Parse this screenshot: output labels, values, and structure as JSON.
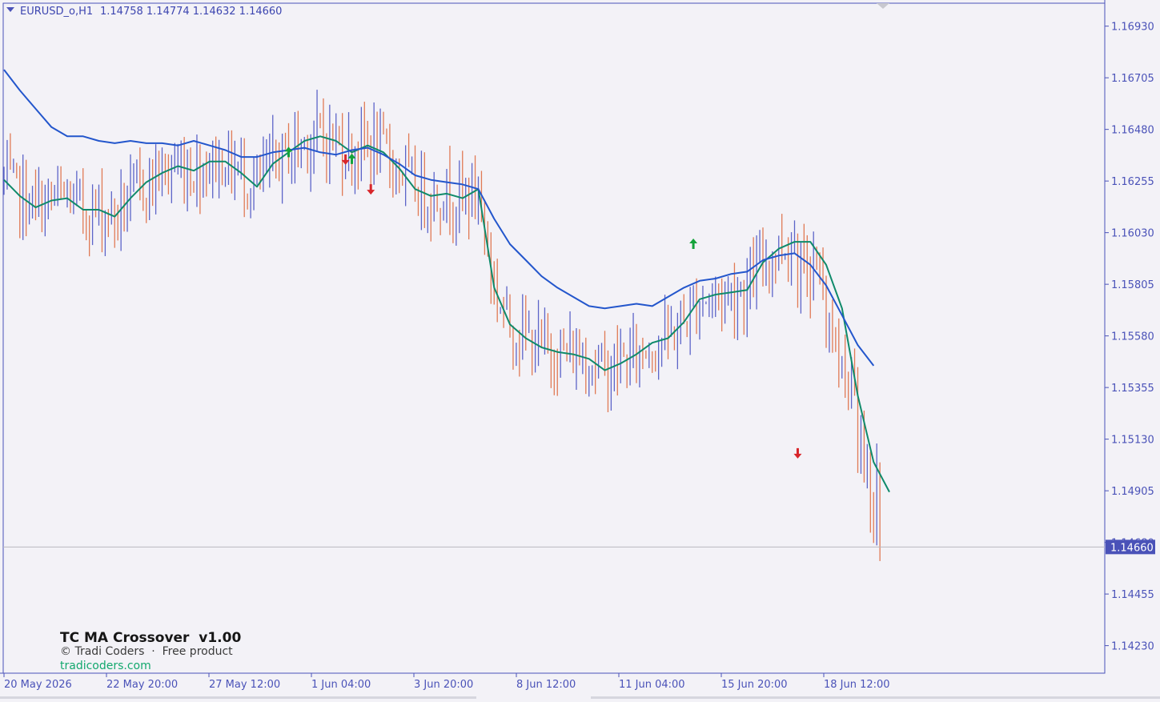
{
  "header": {
    "symbol": "EURUSD_o,H1",
    "ohlc": "1.14758 1.14774 1.14632 1.14660"
  },
  "current_price_label": "1.14660",
  "watermark": {
    "title": "TC MA Crossover  v1.00",
    "line2": "© Tradi Coders  ·  Free product",
    "line3": "tradicoders.com"
  },
  "colors": {
    "background": "#f3f2f7",
    "axis": "#4a52b8",
    "bull_bar": "#5c64c8",
    "bear_bar": "#e07a55",
    "fast_ma": "#0f8a6a",
    "slow_ma": "#2356cc",
    "buy_arrow": "#14a33a",
    "sell_arrow": "#d8252a",
    "price_label_bg": "#4a52b8",
    "watermark_link": "#13a86e"
  },
  "chart_data": {
    "type": "line",
    "title": "",
    "symbol": "EURUSD_o",
    "timeframe": "H1",
    "ylim": [
      1.1411,
      1.1703
    ],
    "y_ticks": [
      1.1693,
      1.16705,
      1.1648,
      1.16255,
      1.1603,
      1.15805,
      1.1558,
      1.15355,
      1.1513,
      1.14905,
      1.1468,
      1.14455,
      1.1423
    ],
    "x_tick_labels": [
      "20 May 2026",
      "22 May 20:00",
      "27 May 12:00",
      "1 Jun 04:00",
      "3 Jun 20:00",
      "8 Jun 12:00",
      "11 Jun 04:00",
      "15 Jun 20:00",
      "18 Jun 12:00"
    ],
    "current_price": 1.1466,
    "series": [
      {
        "kind": "fast_ma",
        "points": [
          [
            0,
            1.1626
          ],
          [
            5,
            1.1619
          ],
          [
            10,
            1.1614
          ],
          [
            15,
            1.1617
          ],
          [
            20,
            1.1618
          ],
          [
            25,
            1.1613
          ],
          [
            30,
            1.1613
          ],
          [
            35,
            1.161
          ],
          [
            40,
            1.1618
          ],
          [
            45,
            1.1625
          ],
          [
            50,
            1.1629
          ],
          [
            55,
            1.1632
          ],
          [
            60,
            1.163
          ],
          [
            65,
            1.1634
          ],
          [
            70,
            1.1634
          ],
          [
            75,
            1.1629
          ],
          [
            80,
            1.1623
          ],
          [
            85,
            1.1633
          ],
          [
            90,
            1.1638
          ],
          [
            95,
            1.1643
          ],
          [
            100,
            1.1645
          ],
          [
            105,
            1.1643
          ],
          [
            110,
            1.1638
          ],
          [
            115,
            1.1641
          ],
          [
            120,
            1.1638
          ],
          [
            125,
            1.1631
          ],
          [
            130,
            1.1622
          ],
          [
            135,
            1.1619
          ],
          [
            140,
            1.162
          ],
          [
            145,
            1.1618
          ],
          [
            150,
            1.1622
          ],
          [
            155,
            1.1579
          ],
          [
            160,
            1.1563
          ],
          [
            165,
            1.1557
          ],
          [
            170,
            1.1553
          ],
          [
            175,
            1.1551
          ],
          [
            180,
            1.155
          ],
          [
            185,
            1.1548
          ],
          [
            190,
            1.1543
          ],
          [
            195,
            1.1546
          ],
          [
            200,
            1.155
          ],
          [
            205,
            1.1555
          ],
          [
            210,
            1.1557
          ],
          [
            215,
            1.1564
          ],
          [
            220,
            1.1574
          ],
          [
            225,
            1.1576
          ],
          [
            230,
            1.1577
          ],
          [
            235,
            1.1578
          ],
          [
            240,
            1.159
          ],
          [
            245,
            1.1596
          ],
          [
            250,
            1.1599
          ],
          [
            255,
            1.1599
          ],
          [
            260,
            1.1589
          ],
          [
            265,
            1.157
          ],
          [
            270,
            1.1532
          ],
          [
            275,
            1.1503
          ],
          [
            280,
            1.149
          ]
        ]
      },
      {
        "kind": "slow_ma",
        "points": [
          [
            0,
            1.1674
          ],
          [
            5,
            1.1665
          ],
          [
            10,
            1.1657
          ],
          [
            15,
            1.1649
          ],
          [
            20,
            1.1645
          ],
          [
            25,
            1.1645
          ],
          [
            30,
            1.1643
          ],
          [
            35,
            1.1642
          ],
          [
            40,
            1.1643
          ],
          [
            45,
            1.1642
          ],
          [
            50,
            1.1642
          ],
          [
            55,
            1.1641
          ],
          [
            60,
            1.1643
          ],
          [
            65,
            1.1641
          ],
          [
            70,
            1.1639
          ],
          [
            75,
            1.1636
          ],
          [
            80,
            1.1636
          ],
          [
            85,
            1.1638
          ],
          [
            90,
            1.1639
          ],
          [
            95,
            1.164
          ],
          [
            100,
            1.1638
          ],
          [
            105,
            1.1637
          ],
          [
            110,
            1.1639
          ],
          [
            115,
            1.164
          ],
          [
            120,
            1.1637
          ],
          [
            125,
            1.1633
          ],
          [
            130,
            1.1628
          ],
          [
            135,
            1.1626
          ],
          [
            140,
            1.1625
          ],
          [
            145,
            1.1624
          ],
          [
            150,
            1.1622
          ],
          [
            155,
            1.1609
          ],
          [
            160,
            1.1598
          ],
          [
            165,
            1.1591
          ],
          [
            170,
            1.1584
          ],
          [
            175,
            1.1579
          ],
          [
            180,
            1.1575
          ],
          [
            185,
            1.1571
          ],
          [
            190,
            1.157
          ],
          [
            195,
            1.1571
          ],
          [
            200,
            1.1572
          ],
          [
            205,
            1.1571
          ],
          [
            210,
            1.1575
          ],
          [
            215,
            1.1579
          ],
          [
            220,
            1.1582
          ],
          [
            225,
            1.1583
          ],
          [
            230,
            1.1585
          ],
          [
            235,
            1.1586
          ],
          [
            240,
            1.1591
          ],
          [
            245,
            1.1593
          ],
          [
            250,
            1.1594
          ],
          [
            255,
            1.1589
          ],
          [
            260,
            1.158
          ],
          [
            265,
            1.1567
          ],
          [
            270,
            1.1554
          ],
          [
            275,
            1.1545
          ]
        ]
      }
    ],
    "signals": [
      {
        "bar": 90,
        "type": "buy",
        "price": 1.1638
      },
      {
        "bar": 108,
        "type": "sell",
        "price": 1.1635
      },
      {
        "bar": 110,
        "type": "buy",
        "price": 1.1635
      },
      {
        "bar": 116,
        "type": "sell",
        "price": 1.1622
      },
      {
        "bar": 218,
        "type": "buy",
        "price": 1.1598
      },
      {
        "bar": 251,
        "type": "sell",
        "price": 1.1507
      }
    ]
  }
}
